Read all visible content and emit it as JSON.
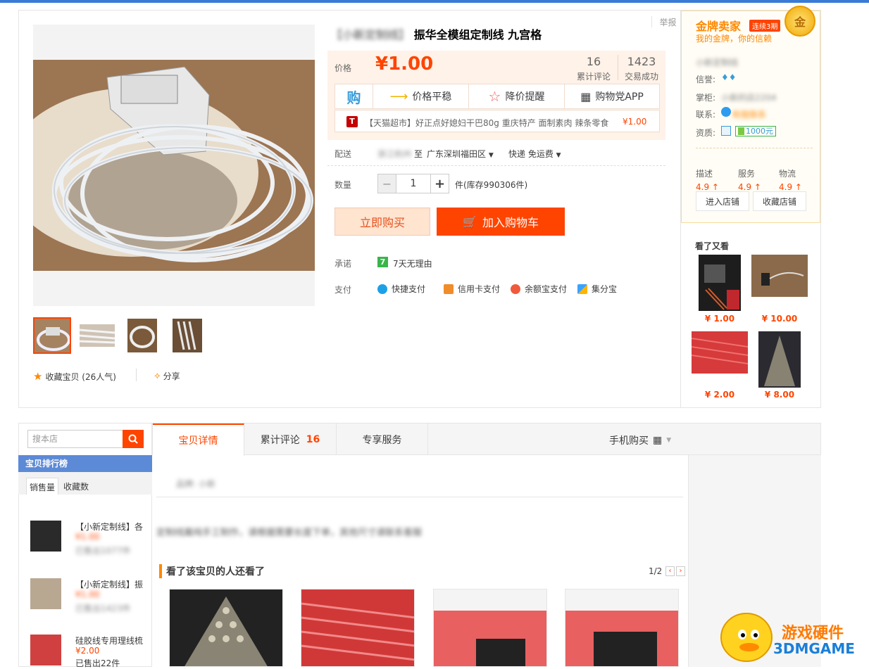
{
  "report_label": "举报",
  "product": {
    "title_blurred": "【小新定制线】",
    "title": "振华全模组定制线 九宫格",
    "price_label": "价格",
    "price": "¥1.00",
    "reviews_count": "16",
    "reviews_label": "累计评论",
    "deals_count": "1423",
    "deals_label": "交易成功",
    "stripe": {
      "gou": "购",
      "price_stable": "价格平稳",
      "price_alert": "降价提醒",
      "app": "购物党APP"
    },
    "tmall_badge": "T",
    "tmall_text": "【天猫超市】好正点好媳妇干巴80g 重庆特产 面制素肉 辣条零食",
    "tmall_price": "¥1.00",
    "delivery_label": "配送",
    "delivery_from": "浙江杭州",
    "delivery_to_word": "至",
    "delivery_to": "广东深圳福田区",
    "delivery_method": "快递 免运费",
    "qty_label": "数量",
    "qty_minus": "−",
    "qty_value": "1",
    "qty_plus": "+",
    "qty_stock": "件(库存990306件)",
    "buy_now": "立即购买",
    "add_cart": "加入购物车",
    "promise_label": "承诺",
    "promise_badge": "7",
    "promise_text": "7天无理由",
    "pay_label": "支付",
    "pay_methods": [
      "快捷支付",
      "信用卡支付",
      "余额宝支付",
      "集分宝"
    ],
    "favorite": "收藏宝贝 (26人气)",
    "share": "分享"
  },
  "seller": {
    "gold_title": "金牌卖家",
    "streak": "连续3期",
    "slogan": "我的金牌，你的信赖",
    "medal": "金",
    "shop_name": "小新定制线",
    "credit_label": "信誉:",
    "keeper_label": "掌柜:",
    "keeper_value": "小新的店2204",
    "contact_label": "联系:",
    "contact_value": "和我联系",
    "qual_label": "资质:",
    "deposit": "1000元",
    "scores": [
      {
        "label": "描述",
        "value": "4.9 ↑"
      },
      {
        "label": "服务",
        "value": "4.9 ↑"
      },
      {
        "label": "物流",
        "value": "4.9 ↑"
      }
    ],
    "enter_shop": "进入店铺",
    "fav_shop": "收藏店铺",
    "see_also_title": "看了又看",
    "see_also_prices": [
      "¥ 1.00",
      "¥ 10.00",
      "¥ 2.00",
      "¥ 8.00"
    ]
  },
  "sidebar": {
    "search_placeholder": "搜本店",
    "rank_title": "宝贝排行榜",
    "tab_sales": "销售量",
    "tab_fav": "收藏数",
    "items": [
      {
        "title": "【小新定制线】各",
        "price": "¥1.00",
        "sold": "已售出1077件"
      },
      {
        "title": "【小新定制线】振",
        "price": "¥1.00",
        "sold": "已售出1423件"
      },
      {
        "title": "硅胶线专用理线梳",
        "price": "¥2.00",
        "sold": "已售出22件"
      }
    ]
  },
  "tabs": {
    "detail": "宝贝详情",
    "reviews": "累计评论",
    "reviews_count": "16",
    "service": "专享服务",
    "mobile": "手机购买"
  },
  "detail": {
    "brand_blurred": "品牌: 小新",
    "desc_blurred": "定制线属纯手工制作，请根据需要长度下单，其他尺寸请联系客服",
    "also_viewed_title": "看了该宝贝的人还看了",
    "pager": "1/2"
  },
  "watermark": {
    "line1": "游戏硬件",
    "line2": "3DMGAME"
  },
  "colors": {
    "accent": "#ff4400",
    "gold": "#ff8800",
    "rank_blue": "#5c8ad6"
  }
}
